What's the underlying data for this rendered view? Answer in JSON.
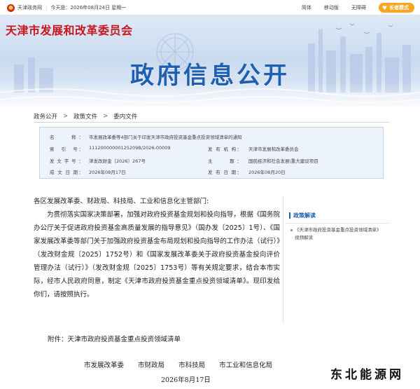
{
  "topbar": {
    "site_link": "天津政务网",
    "date_text": "今天是：2026年08月24日 星期一",
    "links": [
      "简体",
      "无障碍",
      "无障碍"
    ],
    "links_visible": [
      "简体",
      "",
      "无障碍"
    ],
    "care_label": "长者模式"
  },
  "banner": {
    "agency": "天津市发展和改革委员会",
    "headline": "政府信息公开"
  },
  "breadcrumb": [
    "政务公开",
    "政策文件",
    "委内文件"
  ],
  "meta": {
    "name_label": "名　　称：",
    "name_value": "市发展改革委等4部门关于印发天津市政府投资基金重点投资领域清单的通知",
    "index_label": "索　引　号：",
    "index_value": "11120000000125209B/2026-00009",
    "issuer_label": "发 布 机 构：",
    "issuer_value": "天津市发展和改革委员会",
    "docno_label": "发文字号：",
    "docno_value": "津发改财金〔2026〕267号",
    "topic_label": "主　　题：",
    "topic_value": "国民经济和社会发展\\重大建设项目",
    "date_label": "成 文 日 期：",
    "date_value": "2026年08月17日",
    "pub_label": "发 布 日 期：",
    "pub_value": "2026年08月20日"
  },
  "article": {
    "salutation": "各区发展改革委、财政局、科技局、工业和信息化主管部门:",
    "body": "为贯彻落实国家决策部署，加强对政府投资基金规划和投向指导，根据《国务院办公厅关于促进政府投资基金高质量发展的指导意见》（国办发〔2025〕1号）、《国家发展改革委等部门关于加强政府投资基金布局规划和投向指导的工作办法（试行）》（发改财金规〔2025〕1752号）和《国家发展改革委关于政府投资基金投向评价管理办法（试行）》（发改财金规〔2025〕1753号）等有关规定要求，结合本市实际，经市人民政府同意，制定《天津市政府投资基金重点投资领域清单》。现印发给你们，请按照执行。",
    "attachment": "附件：天津市政府投资基金重点投资领域清单",
    "signers": [
      "市发展改革委",
      "市财政局",
      "市科技局",
      "市工业和信息化局"
    ],
    "date": "2026年8月17日"
  },
  "side": {
    "title": "政策解读",
    "items": [
      "《天津市政府投资基金重点投资领域清单》视频解读"
    ]
  },
  "watermark": "东北能源网",
  "colors": {
    "brand_red": "#c8161d",
    "primary_blue": "#1f5fb0",
    "care_orange": "#f5a623"
  }
}
